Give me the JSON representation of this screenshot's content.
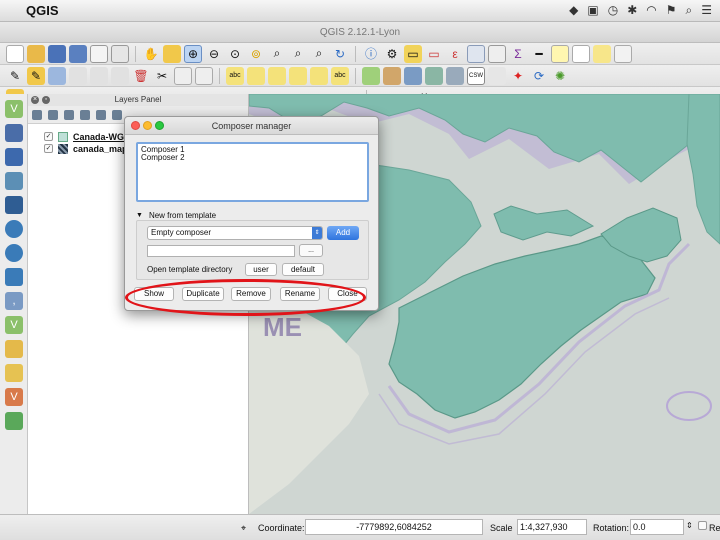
{
  "menubar": {
    "app_name": "QGIS",
    "icons": [
      "dropbox-icon",
      "window-icon",
      "clock-icon",
      "bluetooth-icon",
      "wifi-icon",
      "flag-icon",
      "search-icon",
      "list-icon"
    ]
  },
  "window": {
    "title": "QGIS 2.12.1-Lyon"
  },
  "layers_panel": {
    "title": "Layers Panel",
    "layers": [
      {
        "name": "Canada-WGS",
        "checked": true,
        "type": "vector"
      },
      {
        "name": "canada_map",
        "checked": true,
        "type": "raster"
      }
    ]
  },
  "composer_manager": {
    "title": "Composer manager",
    "composers": [
      "Composer 1",
      "Composer 2"
    ],
    "template_toggle_label": "New from template",
    "template_selected": "Empty composer",
    "add_label": "Add",
    "browse_label": "...",
    "open_dir_label": "Open template directory",
    "user_label": "user",
    "default_label": "default",
    "buttons": {
      "show": "Show",
      "duplicate": "Duplicate",
      "remove": "Remove",
      "rename": "Rename",
      "close": "Close"
    }
  },
  "map": {
    "label": "ME"
  },
  "statusbar": {
    "coordinate_label": "Coordinate:",
    "coordinate_value": "-7779892,6084252",
    "scale_label": "Scale",
    "scale_value": "1:4,327,930",
    "rotation_label": "Rotation:",
    "rotation_value": "0.0",
    "render_label": "Ren"
  },
  "colors": {
    "land": "#7fbcae",
    "ocean": "#cfd6d2",
    "coast_halo": "#b8a9d6",
    "annotation": "#e11419",
    "accent": "#2f74de"
  }
}
